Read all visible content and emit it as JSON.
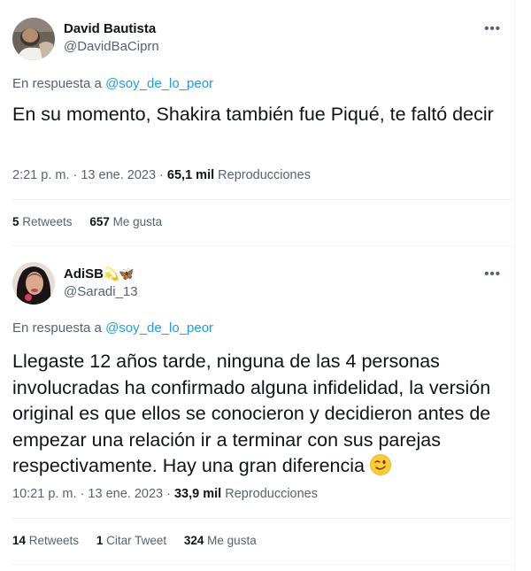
{
  "tweets": [
    {
      "name": "David Bautista",
      "name_extra": "",
      "handle": "@DavidBaCiprn",
      "reply_prefix": "En respuesta a ",
      "reply_to": "@soy_de_lo_peor",
      "text": "En su momento, Shakira también fue Piqué, te faltó decir",
      "time": "2:21 p. m. · 13 ene. 2023 · ",
      "views_count": "65,1 mil",
      "views_label": " Reproducciones",
      "retweets_count": "5",
      "retweets_label": " Retweets",
      "quotes_count": "",
      "quotes_label": "",
      "likes_count": "657",
      "likes_label": " Me gusta"
    },
    {
      "name": "AdiSB",
      "name_extra": "💫🦋",
      "handle": "@Saradi_13",
      "reply_prefix": "En respuesta a ",
      "reply_to": "@soy_de_lo_peor",
      "text": "Llegaste 12 años tarde, ninguna de las 4 personas involucradas ha confirmado alguna infidelidad, la versión original es que ellos se conocieron y decidieron antes de empezar una relación ir a terminar con sus parejas respectivamente. Hay una gran diferencia",
      "text_emoji": "winking-face",
      "time": "10:21 p. m. · 13 ene. 2023 · ",
      "views_count": "33,9 mil",
      "views_label": " Reproducciones",
      "retweets_count": "14",
      "retweets_label": " Retweets",
      "quotes_count": "1",
      "quotes_label": " Citar Tweet",
      "likes_count": "324",
      "likes_label": " Me gusta"
    }
  ],
  "colors": {
    "link": "#1d9bf0",
    "secondary_text": "#536471",
    "primary_text": "#0f1419",
    "divider": "#eff3f4"
  }
}
